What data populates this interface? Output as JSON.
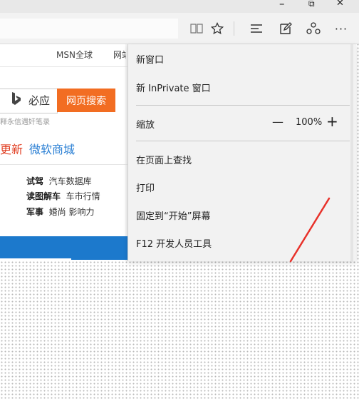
{
  "window": {
    "minimize": "–",
    "restore": "⧉",
    "close": "✕"
  },
  "toolbar": {
    "icons": [
      "reading-view-icon",
      "favorite-star-icon",
      "hub-icon",
      "web-note-icon",
      "share-icon",
      "more-icon"
    ],
    "more_label": "···"
  },
  "page": {
    "msn_link": "MSN全球",
    "web_link": "网站",
    "bing_text": "必应",
    "search_button": "网页搜索",
    "hint_text": "释永信遇奸笔录",
    "gengxin": "更新",
    "shangcheng": "微软商城",
    "categories": [
      {
        "bold": "试驾",
        "rest": "汽车数据库"
      },
      {
        "bold": "读图解车",
        "rest": "车市行情"
      },
      {
        "bold": "军事",
        "rest": "婚尚 影响力"
      }
    ]
  },
  "menu": {
    "items": {
      "new_window": "新窗口",
      "new_inprivate": "新 InPrivate 窗口",
      "zoom_label": "缩放",
      "zoom_value": "100%",
      "zoom_minus": "—",
      "zoom_plus": "+",
      "find_on_page": "在页面上查找",
      "print": "打印",
      "pin_to_start": "固定到“开始”屏幕",
      "f12_tools": "F12 开发人员工具"
    }
  },
  "colors": {
    "search_button": "#f26d22",
    "link_red": "#e03c1f",
    "link_blue": "#2a7fd4",
    "blue_bar": "#1c79cc",
    "annotation_red": "#e8312a"
  }
}
